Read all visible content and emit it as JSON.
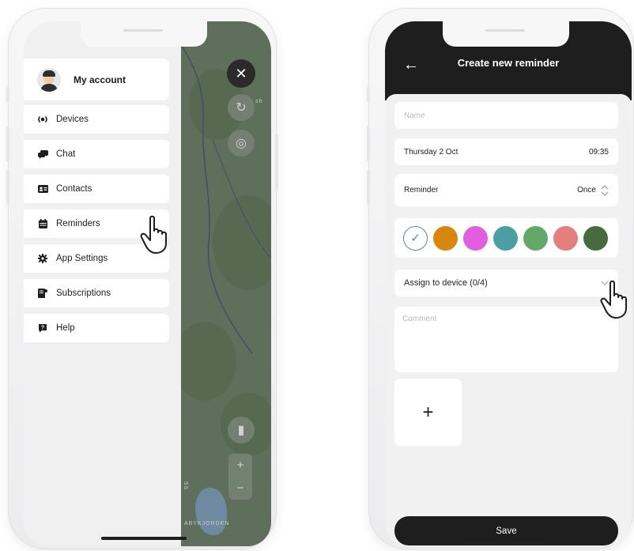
{
  "left_screen": {
    "account": {
      "label": "My account",
      "avatar_icon": "user-avatar-icon"
    },
    "menu": [
      {
        "label": "Devices",
        "icon": "devices-icon",
        "glyph": "(●)"
      },
      {
        "label": "Chat",
        "icon": "chat-icon",
        "glyph": "💬"
      },
      {
        "label": "Contacts",
        "icon": "contacts-icon",
        "glyph": "🪪"
      },
      {
        "label": "Reminders",
        "icon": "calendar-icon",
        "glyph": "📅"
      },
      {
        "label": "App Settings",
        "icon": "gear-icon",
        "glyph": "⚙"
      },
      {
        "label": "Subscriptions",
        "icon": "subscriptions-icon",
        "glyph": "🗒"
      },
      {
        "label": "Help",
        "icon": "help-icon",
        "glyph": "?"
      }
    ],
    "map": {
      "close_glyph": "✕",
      "refresh_glyph": "↻",
      "locate_glyph": "◎",
      "layers_glyph": "▮",
      "zoom_in": "+",
      "zoom_out": "−",
      "map_label_partial": "sh",
      "map_label_bottom": "ABYKJORDEN",
      "map_label_side": "SS"
    }
  },
  "right_screen": {
    "title": "Create new reminder",
    "back_glyph": "←",
    "name_placeholder": "Name",
    "date": "Thursday 2 Oct",
    "time": "09:35",
    "reminder_label": "Reminder",
    "reminder_value": "Once",
    "colors": [
      "#ffffff",
      "#d9860d",
      "#e25ee0",
      "#4a9fa3",
      "#63a966",
      "#e57f7c",
      "#456b3e"
    ],
    "selected_check": "✓",
    "assign_label": "Assign to device (0/4)",
    "comment_placeholder": "Comment",
    "add_glyph": "+",
    "save_label": "Save"
  },
  "accent_colors": {
    "selection": "#5a7fd1",
    "dark": "#1e1e1e"
  }
}
